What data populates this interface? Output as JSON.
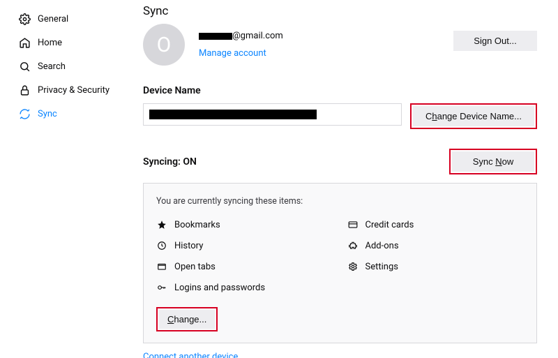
{
  "sidebar": {
    "items": [
      {
        "label": "General"
      },
      {
        "label": "Home"
      },
      {
        "label": "Search"
      },
      {
        "label": "Privacy & Security"
      },
      {
        "label": "Sync"
      }
    ]
  },
  "page": {
    "title": "Sync",
    "avatar_letter": "O",
    "email_domain": "@gmail.com",
    "manage_account": "Manage account",
    "sign_out": "Sign Out...",
    "device_name_heading": "Device Name",
    "change_device_name": "Change Device Name...",
    "syncing_label": "Syncing: ON",
    "sync_now": "Sync Now",
    "sync_intro": "You are currently syncing these items:",
    "items": [
      {
        "label": "Bookmarks"
      },
      {
        "label": "Credit cards"
      },
      {
        "label": "History"
      },
      {
        "label": "Add-ons"
      },
      {
        "label": "Open tabs"
      },
      {
        "label": "Settings"
      },
      {
        "label": "Logins and passwords"
      }
    ],
    "change": "Change...",
    "connect_another": "Connect another device",
    "u_h": "h",
    "u_N": "N",
    "u_C": "C"
  }
}
